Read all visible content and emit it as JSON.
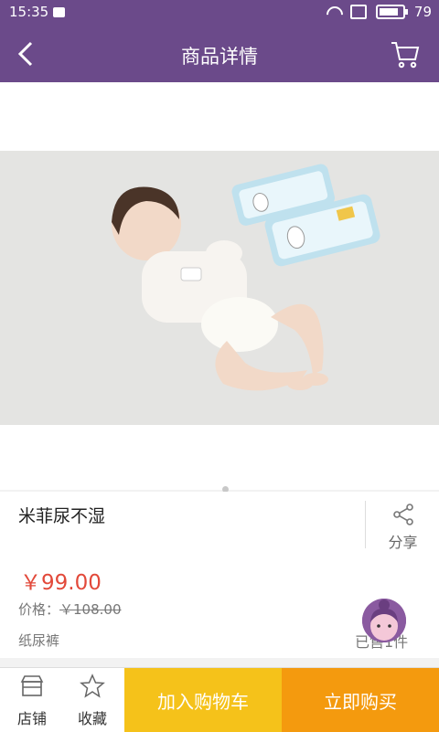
{
  "status_bar": {
    "time": "15:35",
    "battery": "79"
  },
  "header": {
    "title": "商品详情"
  },
  "product": {
    "name": "米菲尿不湿",
    "share_label": "分享",
    "price": "￥99.00",
    "original_price_label": "价格：",
    "original_price": "￥108.00",
    "category": "纸尿裤",
    "sold": "已售1件"
  },
  "bottom_bar": {
    "store_label": "店铺",
    "favorite_label": "收藏",
    "add_to_cart_label": "加入购物车",
    "buy_now_label": "立即购买"
  },
  "colors": {
    "header_bg": "#6b4a8a",
    "price": "#e2493a",
    "add_to_cart_bg": "#f5c21a",
    "buy_now_bg": "#f49a0e"
  }
}
